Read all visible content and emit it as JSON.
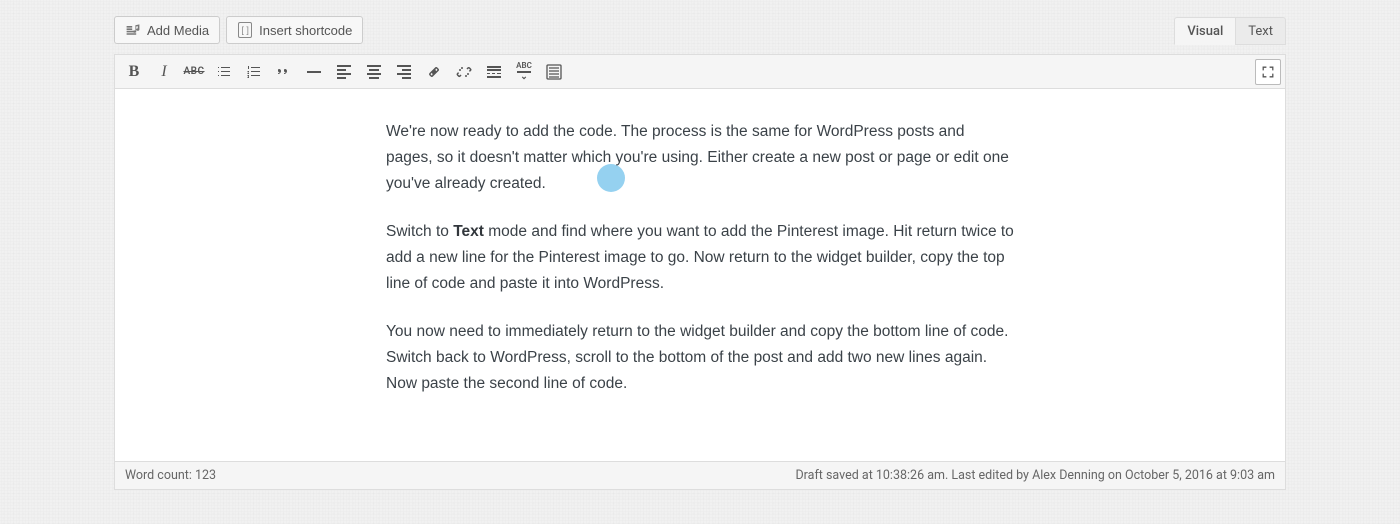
{
  "buttons": {
    "add_media": "Add Media",
    "insert_shortcode": "Insert shortcode"
  },
  "tabs": {
    "visual": "Visual",
    "text": "Text",
    "active": "visual"
  },
  "toolbar": {
    "bold": "B",
    "italic": "I",
    "strike": "ABC",
    "spell": "ABC"
  },
  "content": {
    "p1": "We're now ready to add the code. The process is the same for WordPress posts and pages, so it doesn't matter which you're using. Either create a new post or page or edit one you've already created.",
    "p2_pre": "Switch to ",
    "p2_bold": "Text",
    "p2_post": " mode and find where you want to add the Pinterest image. Hit return twice to add a new line for the Pinterest image to go. Now return to the widget builder, copy the top line of code and paste it into WordPress.",
    "p3": "You now need to immediately return to the widget builder and copy the bottom line of code. Switch back to WordPress, scroll to the bottom of the post and add two new lines again. Now paste the second line of code."
  },
  "status": {
    "word_count_label": "Word count: ",
    "word_count_value": "123",
    "right": "Draft saved at 10:38:26 am. Last edited by Alex Denning on October 5, 2016 at 9:03 am"
  }
}
